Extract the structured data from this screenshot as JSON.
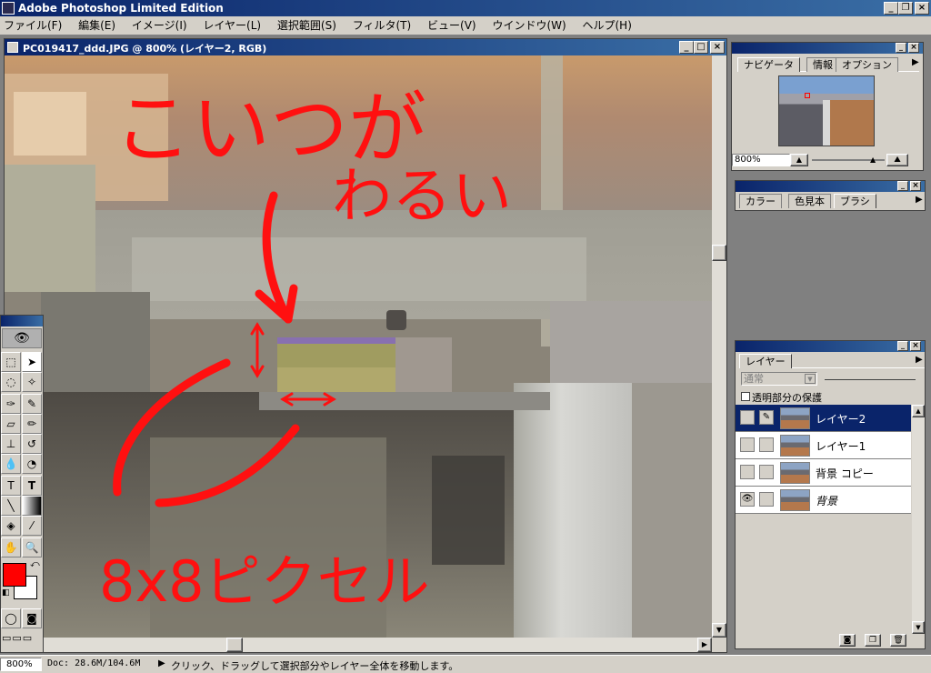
{
  "app": {
    "title": "Adobe Photoshop Limited Edition",
    "menu": [
      "ファイル(F)",
      "編集(E)",
      "イメージ(I)",
      "レイヤー(L)",
      "選択範囲(S)",
      "フィルタ(T)",
      "ビュー(V)",
      "ウインドウ(W)",
      "ヘルプ(H)"
    ]
  },
  "document": {
    "title": "PC019417_ddd.JPG @ 800% (レイヤー2, RGB)"
  },
  "annotations": {
    "line1": "こいつが",
    "line2": "わるい",
    "bottom": "8x8ピクセル"
  },
  "navigator": {
    "tabs": [
      "ナビゲータ",
      "情報",
      "オプション"
    ],
    "zoom_value": "800%"
  },
  "color_panel": {
    "tabs": [
      "カラー",
      "色見本",
      "ブラシ"
    ]
  },
  "layers_panel": {
    "tab": "レイヤー",
    "blend_mode": "通常",
    "preserve_transparency": "透明部分の保護",
    "layers": [
      {
        "name": "レイヤー2",
        "selected": true,
        "visible": false,
        "brush": true
      },
      {
        "name": "レイヤー1",
        "selected": false,
        "visible": false,
        "brush": false
      },
      {
        "name": "背景 コピー",
        "selected": false,
        "visible": false,
        "brush": false
      },
      {
        "name": "背景",
        "selected": false,
        "visible": true,
        "brush": false
      }
    ]
  },
  "colors": {
    "foreground": "#ff0000",
    "background": "#ffffff",
    "annotation": "#ff1010"
  },
  "status": {
    "zoom": "800%",
    "doc_info": "Doc: 28.6M/104.6M",
    "hint": "クリック、ドラッグして選択部分やレイヤー全体を移動します。"
  }
}
